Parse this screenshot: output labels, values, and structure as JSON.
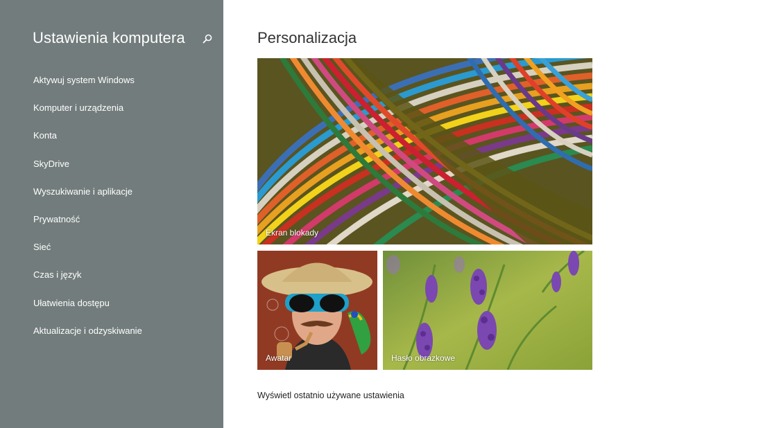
{
  "sidebar": {
    "title": "Ustawienia komputera",
    "search_icon": "search-icon",
    "background_color": "#737c7c",
    "items": [
      {
        "label": "Aktywuj system Windows"
      },
      {
        "label": "Komputer i urządzenia"
      },
      {
        "label": "Konta"
      },
      {
        "label": "SkyDrive"
      },
      {
        "label": "Wyszukiwanie i aplikacje"
      },
      {
        "label": "Prywatność"
      },
      {
        "label": "Sieć"
      },
      {
        "label": "Czas i język"
      },
      {
        "label": "Ułatwienia dostępu"
      },
      {
        "label": "Aktualizacje i odzyskiwanie"
      }
    ]
  },
  "main": {
    "title": "Personalizacja",
    "tiles": {
      "lock_screen": {
        "label": "Ekran blokady"
      },
      "avatar": {
        "label": "Awatar"
      },
      "picture_password": {
        "label": "Hasło obrazkowe"
      }
    },
    "recent_link": "Wyświetl ostatnio używane ustawienia"
  }
}
